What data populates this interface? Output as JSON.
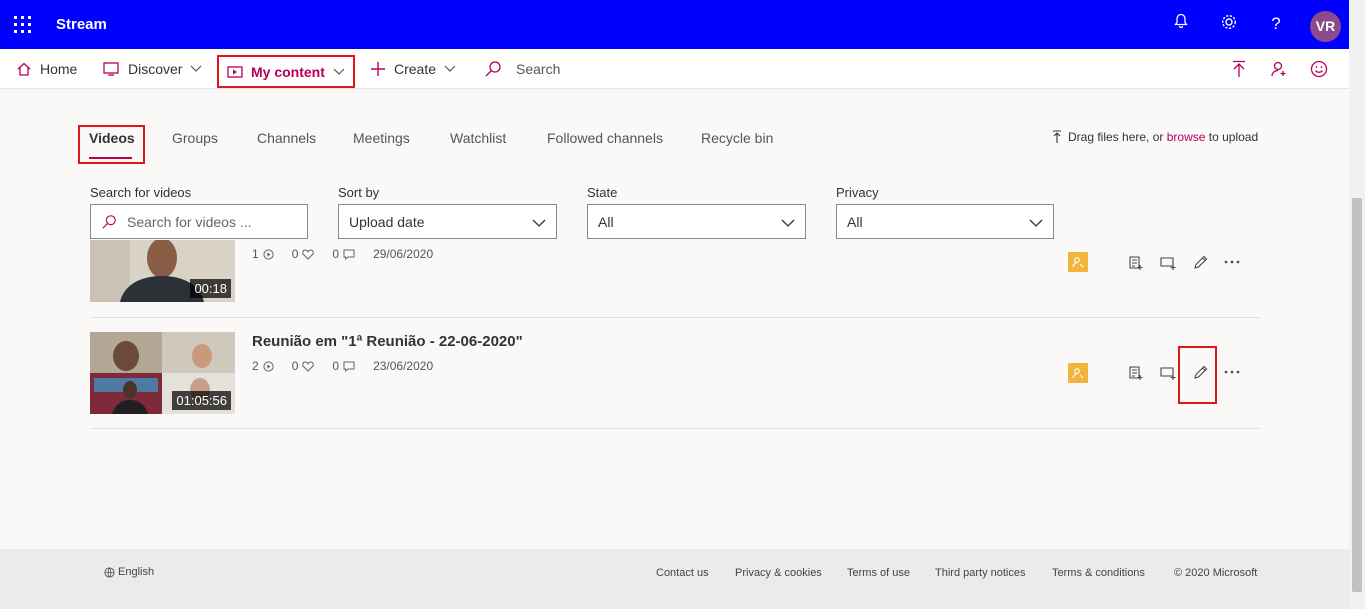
{
  "app": {
    "name": "Stream",
    "user_initials": "VR"
  },
  "topbar": {
    "icons": [
      "waffle-icon",
      "bell-icon",
      "gear-icon",
      "help-icon"
    ],
    "help_glyph": "?"
  },
  "nav": {
    "home": "Home",
    "discover": "Discover",
    "my_content": "My content",
    "create": "Create",
    "search_placeholder": "Search"
  },
  "tabs": [
    "Videos",
    "Groups",
    "Channels",
    "Meetings",
    "Watchlist",
    "Followed channels",
    "Recycle bin"
  ],
  "upload": {
    "prefix": "Drag files here, or",
    "link": "browse",
    "suffix": "to upload"
  },
  "filters": {
    "search": {
      "label": "Search for videos",
      "placeholder": "Search for videos ..."
    },
    "sort": {
      "label": "Sort by",
      "value": "Upload date"
    },
    "state": {
      "label": "State",
      "value": "All"
    },
    "privacy": {
      "label": "Privacy",
      "value": "All"
    }
  },
  "videos": [
    {
      "title": "",
      "duration": "00:18",
      "views": "1",
      "likes": "0",
      "comments": "0",
      "date": "29/06/2020"
    },
    {
      "title": "Reunião em \"1ª Reunião - 22-06-2020\"",
      "duration": "01:05:56",
      "views": "2",
      "likes": "0",
      "comments": "0",
      "date": "23/06/2020"
    }
  ],
  "footer": {
    "language": "English",
    "links": [
      "Contact us",
      "Privacy & cookies",
      "Terms of use",
      "Third party notices",
      "Terms & conditions"
    ],
    "copyright": "© 2020 Microsoft"
  },
  "colors": {
    "header": "#0000ff",
    "accent": "#b4005a",
    "highlight": "#e0161b",
    "permission": "#f2b43c"
  }
}
